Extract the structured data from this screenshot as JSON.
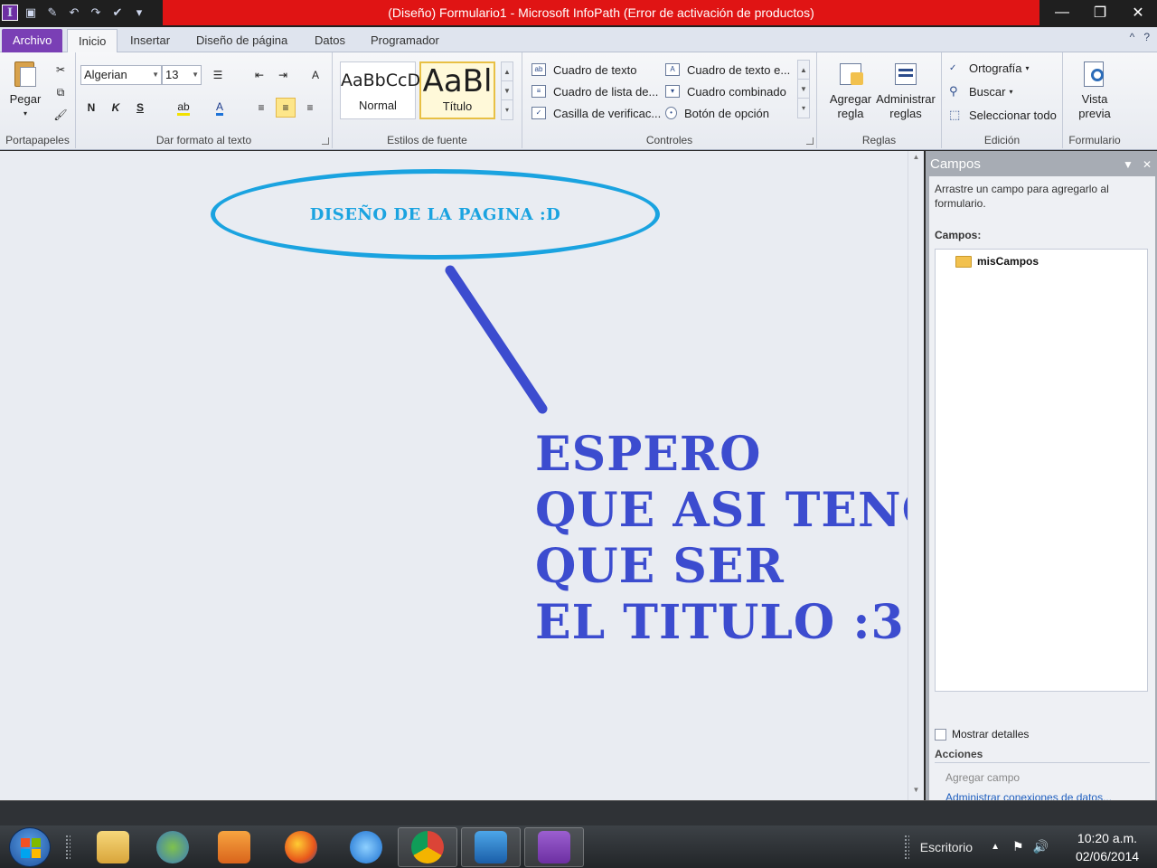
{
  "window": {
    "title": "(Diseño) Formulario1  -  Microsoft InfoPath (Error de activación de productos)",
    "controls": [
      "—",
      "❐",
      "✕"
    ]
  },
  "tabs": [
    {
      "label": "Archivo"
    },
    {
      "label": "Inicio"
    },
    {
      "label": "Insertar"
    },
    {
      "label": "Diseño de página"
    },
    {
      "label": "Datos"
    },
    {
      "label": "Programador"
    }
  ],
  "ribbon": {
    "clipboard": {
      "paste": "Pegar",
      "label": "Portapapeles"
    },
    "font": {
      "name": "Algerian",
      "size": "13",
      "bold": "N",
      "italic": "K",
      "underline": "S",
      "label": "Dar formato al texto"
    },
    "styles": {
      "normal_sample": "AaBbCcD",
      "normal": "Normal",
      "title_sample": "AaBl",
      "title": "Título",
      "label": "Estilos de fuente"
    },
    "controls": {
      "items": [
        "Cuadro de texto",
        "Cuadro de texto e...",
        "Cuadro de lista de...",
        "Cuadro combinado",
        "Casilla de verificac...",
        "Botón de opción"
      ],
      "label": "Controles"
    },
    "rules": {
      "add": [
        "Agregar",
        "regla"
      ],
      "manage": [
        "Administrar",
        "reglas"
      ],
      "label": "Reglas"
    },
    "editing": {
      "spelling": "Ortografía",
      "find": "Buscar",
      "select_all": "Seleccionar todo",
      "label": "Edición"
    },
    "form": {
      "preview": [
        "Vista",
        "previa"
      ],
      "label": "Formulario"
    }
  },
  "canvas": {
    "bubble_text": "DISEÑO DE LA PAGINA :D",
    "title_lines": [
      "ESPERO",
      "QUE ASI TENGA",
      "QUE SER",
      "EL TITULO :3"
    ]
  },
  "pane": {
    "title": "Campos",
    "help": "Arrastre un campo para agregarlo al formulario.",
    "fields_label": "Campos:",
    "root": "misCampos",
    "show_details": "Mostrar detalles",
    "actions_label": "Acciones",
    "add_field": "Agregar campo",
    "manage_connections": "Administrar conexiones de datos..."
  },
  "taskbar": {
    "desktop": "Escritorio",
    "time": "10:20 a.m.",
    "date": "02/06/2014"
  },
  "colors": {
    "accent_file_tab": "#7a3fb5",
    "titlebar_error": "#e01414",
    "bubble": "#1aa3e0",
    "title_text": "#3c4ccf"
  }
}
